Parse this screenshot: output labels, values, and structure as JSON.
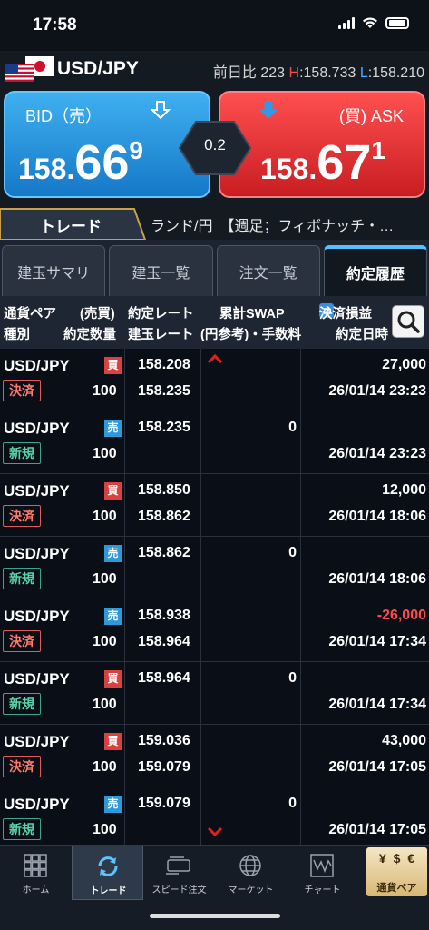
{
  "status": {
    "time": "17:58"
  },
  "header": {
    "pair": "USD/JPY",
    "change_label": "前日比",
    "change_value": "223",
    "high_label": "H",
    "high_value": ":158.733",
    "low_label": "L",
    "low_value": ":158.210"
  },
  "quote": {
    "bid_label": "BID（売）",
    "bid_head": "158.",
    "bid_big": "66",
    "bid_tail": "9",
    "ask_label": "(買) ASK",
    "ask_head": "158.",
    "ask_big": "67",
    "ask_tail": "1",
    "spread": "0.2",
    "colors": {
      "bid": "#1e8de0",
      "ask": "#e03036"
    }
  },
  "mode": {
    "tab": "トレード",
    "ticker": "ランド/円　【週足；フィボナッチ・…"
  },
  "tabs": [
    {
      "label": "建玉サマリ"
    },
    {
      "label": "建玉一覧"
    },
    {
      "label": "注文一覧"
    },
    {
      "label": "約定履歴"
    }
  ],
  "columns": {
    "pair": "通貨ペア",
    "side": "(売買)",
    "exec_rate": "約定レート",
    "swap": "累計SWAP",
    "pl": "決済損益",
    "kind": "種別",
    "qty": "約定数量",
    "pos_rate": "建玉レート",
    "fee": "(円参考)・手数料",
    "date": "約定日時"
  },
  "rows": [
    {
      "pair": "USD/JPY",
      "side": "買",
      "kind": "決済",
      "qty": "100",
      "rate": "158.208",
      "rate2": "158.235",
      "swap": "",
      "pl": "27,000",
      "date": "26/01/14 23:23"
    },
    {
      "pair": "USD/JPY",
      "side": "売",
      "kind": "新規",
      "qty": "100",
      "rate": "158.235",
      "rate2": "",
      "swap": "0",
      "pl": "",
      "date": "26/01/14 23:23"
    },
    {
      "pair": "USD/JPY",
      "side": "買",
      "kind": "決済",
      "qty": "100",
      "rate": "158.850",
      "rate2": "158.862",
      "swap": "",
      "pl": "12,000",
      "date": "26/01/14 18:06"
    },
    {
      "pair": "USD/JPY",
      "side": "売",
      "kind": "新規",
      "qty": "100",
      "rate": "158.862",
      "rate2": "",
      "swap": "0",
      "pl": "",
      "date": "26/01/14 18:06"
    },
    {
      "pair": "USD/JPY",
      "side": "売",
      "kind": "決済",
      "qty": "100",
      "rate": "158.938",
      "rate2": "158.964",
      "swap": "",
      "pl": "-26,000",
      "date": "26/01/14 17:34"
    },
    {
      "pair": "USD/JPY",
      "side": "買",
      "kind": "新規",
      "qty": "100",
      "rate": "158.964",
      "rate2": "",
      "swap": "0",
      "pl": "",
      "date": "26/01/14 17:34"
    },
    {
      "pair": "USD/JPY",
      "side": "買",
      "kind": "決済",
      "qty": "100",
      "rate": "159.036",
      "rate2": "159.079",
      "swap": "",
      "pl": "43,000",
      "date": "26/01/14 17:05"
    },
    {
      "pair": "USD/JPY",
      "side": "売",
      "kind": "新規",
      "qty": "100",
      "rate": "159.079",
      "rate2": "",
      "swap": "0",
      "pl": "",
      "date": "26/01/14 17:05"
    }
  ],
  "nav": [
    {
      "label": "ホーム",
      "icon": "grid-icon"
    },
    {
      "label": "トレード",
      "icon": "refresh-arrows-icon"
    },
    {
      "label": "スピード注文",
      "icon": "speed-icon"
    },
    {
      "label": "マーケット",
      "icon": "globe-icon"
    },
    {
      "label": "チャート",
      "icon": "chart-icon"
    },
    {
      "label": "通貨ペア",
      "icon": "currency-icon"
    }
  ]
}
